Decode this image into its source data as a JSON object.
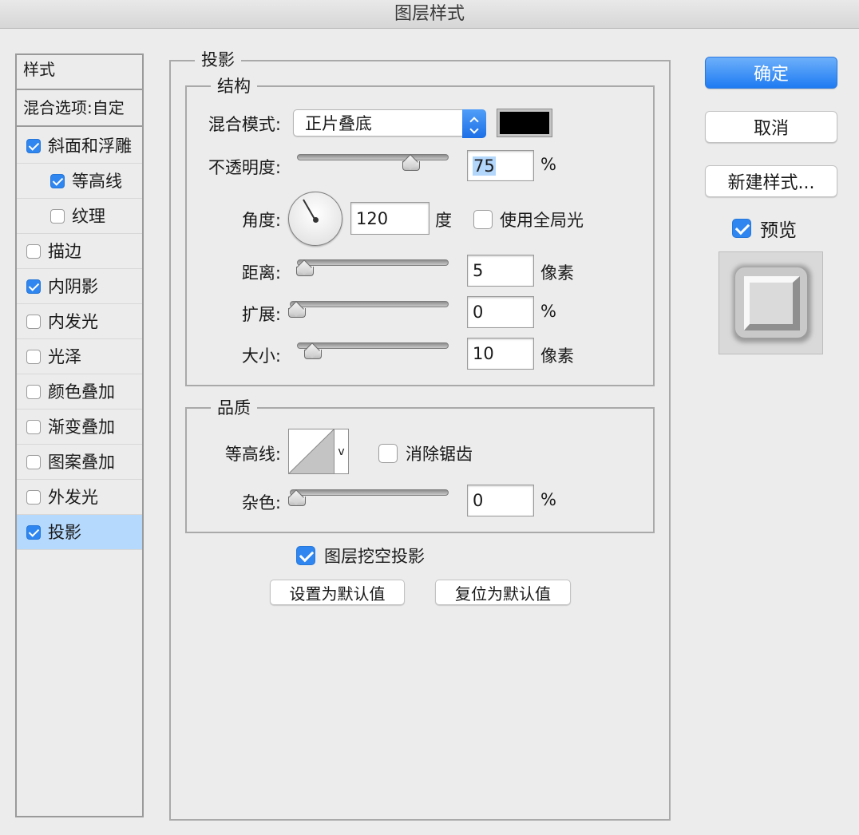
{
  "window": {
    "title": "图层样式"
  },
  "style_list": {
    "header": "样式",
    "blend_options": "混合选项:自定",
    "items": [
      {
        "label": "斜面和浮雕",
        "checked": true,
        "indent": false,
        "selected": false
      },
      {
        "label": "等高线",
        "checked": true,
        "indent": true,
        "selected": false
      },
      {
        "label": "纹理",
        "checked": false,
        "indent": true,
        "selected": false
      },
      {
        "label": "描边",
        "checked": false,
        "indent": false,
        "selected": false
      },
      {
        "label": "内阴影",
        "checked": true,
        "indent": false,
        "selected": false
      },
      {
        "label": "内发光",
        "checked": false,
        "indent": false,
        "selected": false
      },
      {
        "label": "光泽",
        "checked": false,
        "indent": false,
        "selected": false
      },
      {
        "label": "颜色叠加",
        "checked": false,
        "indent": false,
        "selected": false
      },
      {
        "label": "渐变叠加",
        "checked": false,
        "indent": false,
        "selected": false
      },
      {
        "label": "图案叠加",
        "checked": false,
        "indent": false,
        "selected": false
      },
      {
        "label": "外发光",
        "checked": false,
        "indent": false,
        "selected": false
      },
      {
        "label": "投影",
        "checked": true,
        "indent": false,
        "selected": true
      }
    ]
  },
  "drop_shadow": {
    "title": "投影",
    "structure": {
      "title": "结构",
      "blend_mode_label": "混合模式:",
      "blend_mode_value": "正片叠底",
      "shadow_color": "#000000",
      "opacity_label": "不透明度:",
      "opacity_value": "75",
      "opacity_unit": "%",
      "opacity_level": 0.75,
      "angle_label": "角度:",
      "angle_value": "120",
      "angle_unit": "度",
      "global_light_label": "使用全局光",
      "global_light_checked": false,
      "distance_label": "距离:",
      "distance_value": "5",
      "distance_unit": "像素",
      "spread_label": "扩展:",
      "spread_value": "0",
      "spread_unit": "%",
      "size_label": "大小:",
      "size_value": "10",
      "size_unit": "像素"
    },
    "quality": {
      "title": "品质",
      "contour_label": "等高线:",
      "contour_arrow": "v",
      "antialias_label": "消除锯齿",
      "antialias_checked": false,
      "noise_label": "杂色:",
      "noise_value": "0",
      "noise_unit": "%"
    },
    "knockout_label": "图层挖空投影",
    "knockout_checked": true,
    "set_default_label": "设置为默认值",
    "reset_default_label": "复位为默认值"
  },
  "actions": {
    "ok_label": "确定",
    "cancel_label": "取消",
    "new_style_label": "新建样式...",
    "preview_label": "预览",
    "preview_checked": true
  },
  "colors": {
    "accent": "#1f7bf2",
    "selected_row": "#b5d8fd",
    "background": "#ececec"
  }
}
